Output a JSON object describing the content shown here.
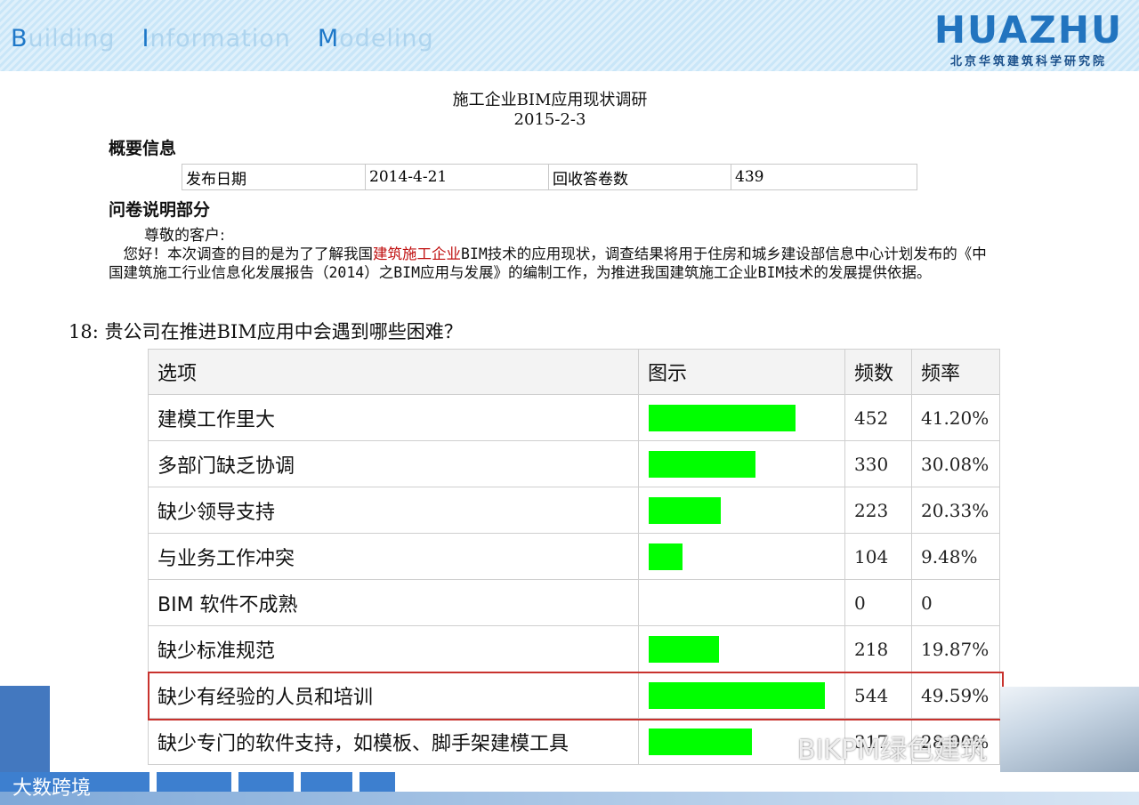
{
  "header": {
    "bim_parts": [
      {
        "cap": "B",
        "rest": "uilding"
      },
      {
        "cap": "I",
        "rest": "nformation"
      },
      {
        "cap": "M",
        "rest": "odeling"
      }
    ],
    "logo_word": "HUAZHU",
    "logo_sub": "北京华筑建筑科学研究院"
  },
  "document": {
    "title": "施工企业BIM应用现状调研",
    "date": "2015-2-3",
    "overview_heading": "概要信息",
    "info": {
      "publish_label": "发布日期",
      "publish_value": "2014-4-21",
      "responses_label": "回收答卷数",
      "responses_value": "439"
    },
    "intro_heading": "问卷说明部分",
    "greeting": "尊敬的客户:",
    "paragraph_pre": "　您好！本次调查的目的是为了了解我国",
    "paragraph_red": "建筑施工企业",
    "paragraph_post": "BIM技术的应用现状，调查结果将用于住房和城乡建设部信息中心计划发布的《中国建筑施工行业信息化发展报告（2014）之BIM应用与发展》的编制工作，为推进我国建筑施工企业BIM技术的发展提供依据。"
  },
  "question": "18: 贵公司在推进BIM应用中会遇到哪些困难？",
  "table_headers": [
    "选项",
    "图示",
    "频数",
    "频率"
  ],
  "chart_data": {
    "type": "table",
    "bar_color": "#00ff00",
    "highlight_color": "#c8322d",
    "highlight_row": 6,
    "rows": [
      {
        "option": "建模工作里大",
        "count": 452,
        "freq": "41.20%",
        "value": 41.2
      },
      {
        "option": "多部门缺乏协调",
        "count": 330,
        "freq": "30.08%",
        "value": 30.08
      },
      {
        "option": "缺少领导支持",
        "count": 223,
        "freq": "20.33%",
        "value": 20.33
      },
      {
        "option": "与业务工作冲突",
        "count": 104,
        "freq": "9.48%",
        "value": 9.48
      },
      {
        "option": "BIM 软件不成熟",
        "count": 0,
        "freq": "0",
        "value": 0
      },
      {
        "option": "缺少标准规范",
        "count": 218,
        "freq": "19.87%",
        "value": 19.87
      },
      {
        "option": "缺少有经验的人员和培训",
        "count": 544,
        "freq": "49.59%",
        "value": 49.59
      },
      {
        "option": "缺少专门的软件支持，如模板、脚手架建模工具",
        "count": "317",
        "freq": "28.90%",
        "value": 28.9
      }
    ]
  },
  "watermarks": {
    "left": "大数跨境",
    "right": "BIKPM绿色建筑"
  }
}
